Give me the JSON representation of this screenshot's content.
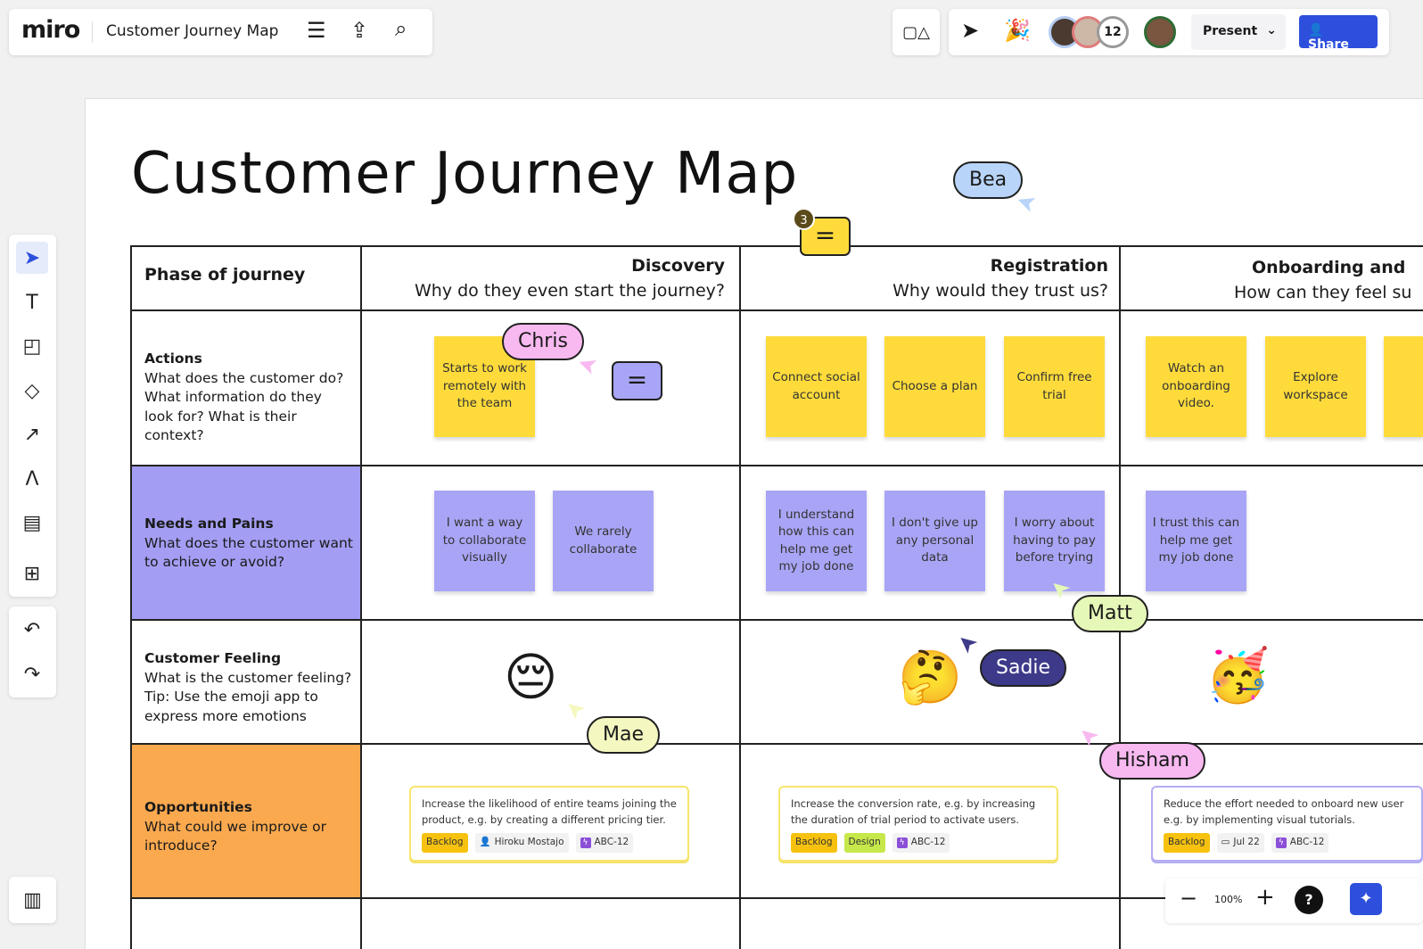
{
  "topbar": {
    "logo": "miro",
    "board_title": "Customer Journey Map",
    "present_label": "Present",
    "share_label": "Share",
    "collaborator_count": "12"
  },
  "board": {
    "title": "Customer Journey Map"
  },
  "table": {
    "corner": "Phase of journey",
    "columns": [
      {
        "title": "Discovery",
        "subtitle": "Why do they even start the journey?"
      },
      {
        "title": "Registration",
        "subtitle": "Why would they trust us?"
      },
      {
        "title": "Onboarding and",
        "subtitle": "How can they feel su"
      }
    ],
    "rows": [
      {
        "title": "Actions",
        "desc": "What does the customer do? What information do they look for? What is their context?"
      },
      {
        "title": "Needs and Pains",
        "desc": "What does the customer want to achieve or avoid?",
        "color": "#a39ef3"
      },
      {
        "title": "Customer Feeling",
        "desc": "What is the customer feeling? Tip: Use the emoji app to express more emotions"
      },
      {
        "title": "Opportunities",
        "desc": "What could we improve or introduce?",
        "color": "#fba94f"
      }
    ]
  },
  "stickies": {
    "actions": [
      "Starts to work remotely with the team",
      "Connect social account",
      "Choose a plan",
      "Confirm free trial",
      "Watch an onboarding video.",
      "Explore workspace"
    ],
    "needs": [
      "I want a way to collaborate visually",
      "We rarely collaborate",
      "I understand how this can help me get my job done",
      "I don't give up any personal data",
      "I worry about having to pay before trying",
      "I trust this can help me get my job done"
    ]
  },
  "emojis": [
    "😔",
    "🤔",
    "🥳"
  ],
  "cards": [
    {
      "text": "Increase the likelihood of entire teams joining the product, e.g. by creating a different pricing tier.",
      "status": "Backlog",
      "assignee": "Hiroku Mostajo",
      "issue": "ABC-12"
    },
    {
      "text": "Increase the conversion rate, e.g. by increasing the duration of trial period to activate users.",
      "status": "Backlog",
      "label": "Design",
      "issue": "ABC-12"
    },
    {
      "text": "Reduce the effort needed to onboard new user e.g. by implementing visual tutorials.",
      "status": "Backlog",
      "date": "Jul 22",
      "issue": "ABC-12"
    }
  ],
  "cursors": [
    "Bea",
    "Chris",
    "Matt",
    "Sadie",
    "Mae",
    "Hisham"
  ],
  "comment_count": "3",
  "zoom": {
    "level": "100%"
  },
  "colors": {
    "sticky_yellow": "#fedb3b",
    "sticky_purple": "#a9a5f6",
    "share_blue": "#2d4fdc"
  }
}
